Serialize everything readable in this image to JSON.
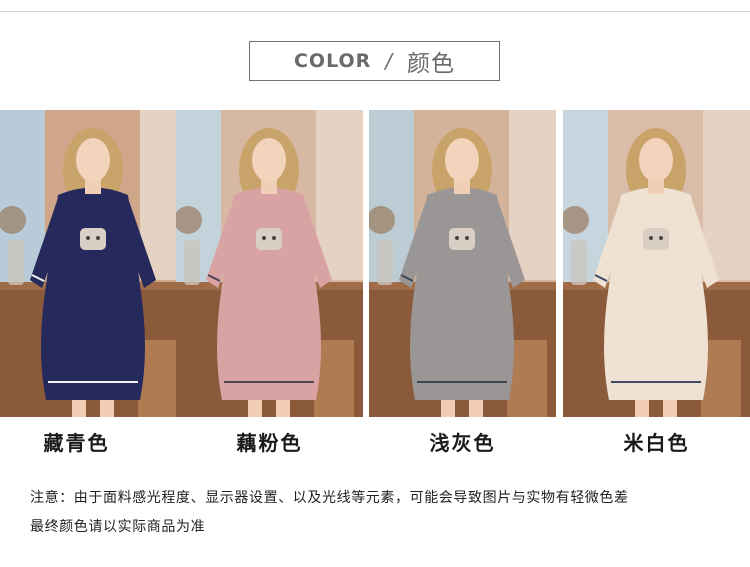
{
  "header": {
    "en": "COLOR",
    "separator": "/",
    "zh": "颜色"
  },
  "variants": [
    {
      "label": "藏青色",
      "dress_color": "#26295c",
      "trim_color": "#f2f2f2",
      "wall": "#cfa68a",
      "window": "#b7cbd8"
    },
    {
      "label": "藕粉色",
      "dress_color": "#d9a3a4",
      "trim_color": "#4d4452",
      "wall": "#d7b8a3",
      "window": "#c3d3dc"
    },
    {
      "label": "浅灰色",
      "dress_color": "#9a9696",
      "trim_color": "#3e4652",
      "wall": "#d3b49b",
      "window": "#bccbd4"
    },
    {
      "label": "米白色",
      "dress_color": "#efe2d3",
      "trim_color": "#3e4a63",
      "wall": "#d9bda8",
      "window": "#c7d5df"
    }
  ],
  "notes": {
    "line1": "注意：由于面料感光程度、显示器设置、以及光线等元素，可能会导致图片与实物有轻微色差",
    "line2": "最终颜色请以实际商品为准"
  }
}
